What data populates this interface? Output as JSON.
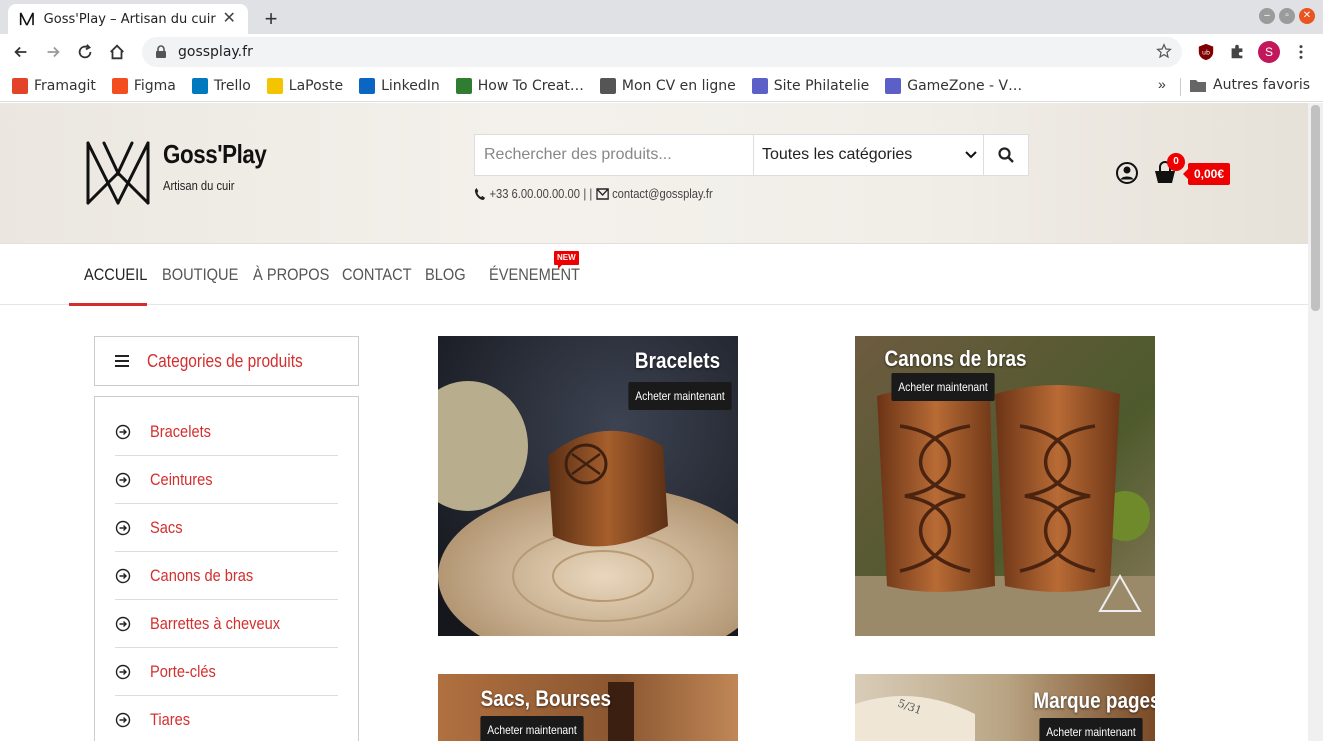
{
  "browser": {
    "tab_title": "Goss'Play – Artisan du cuir",
    "url": "gossplay.fr",
    "profile_initial": "S",
    "bookmarks": [
      {
        "label": "Framagit",
        "color": "#e24329"
      },
      {
        "label": "Figma",
        "color": "#f24e1e"
      },
      {
        "label": "Trello",
        "color": "#0079bf"
      },
      {
        "label": "LaPoste",
        "color": "#f5c400"
      },
      {
        "label": "LinkedIn",
        "color": "#0a66c2"
      },
      {
        "label": "How To Creat…",
        "color": "#2e7d32"
      },
      {
        "label": "Mon CV en ligne",
        "color": "#555555"
      },
      {
        "label": "Site Philatelie",
        "color": "#5b5fc7"
      },
      {
        "label": "GameZone - V…",
        "color": "#5b5fc7"
      }
    ],
    "more_label": "»",
    "other_bookmarks": "Autres favoris"
  },
  "site": {
    "title": "Goss'Play",
    "tagline": "Artisan du cuir",
    "search_placeholder": "Rechercher des produits...",
    "category_select": "Toutes les catégories",
    "phone": "+33 6.00.00.00.00",
    "separator": "| |",
    "email": "contact@gossplay.fr",
    "cart_count": "0",
    "cart_total": "0,00€",
    "accent": "#d32f2f"
  },
  "nav": {
    "items": [
      "Accueil",
      "Boutique",
      "À propos",
      "Contact",
      "Blog",
      "Évenement"
    ],
    "new_badge": "NEW"
  },
  "sidebar": {
    "header": "Categories de produits",
    "categories": [
      "Bracelets",
      "Ceintures",
      "Sacs",
      "Canons de bras",
      "Barrettes à cheveux",
      "Porte-clés",
      "Tiares"
    ]
  },
  "products": [
    {
      "title": "Bracelets",
      "cta": "Acheter maintenant"
    },
    {
      "title": "Canons de bras",
      "cta": "Acheter maintenant"
    },
    {
      "title": "Sacs, Bourses",
      "cta": "Acheter maintenant"
    },
    {
      "title": "Marque pages",
      "cta": "Acheter maintenant"
    }
  ]
}
